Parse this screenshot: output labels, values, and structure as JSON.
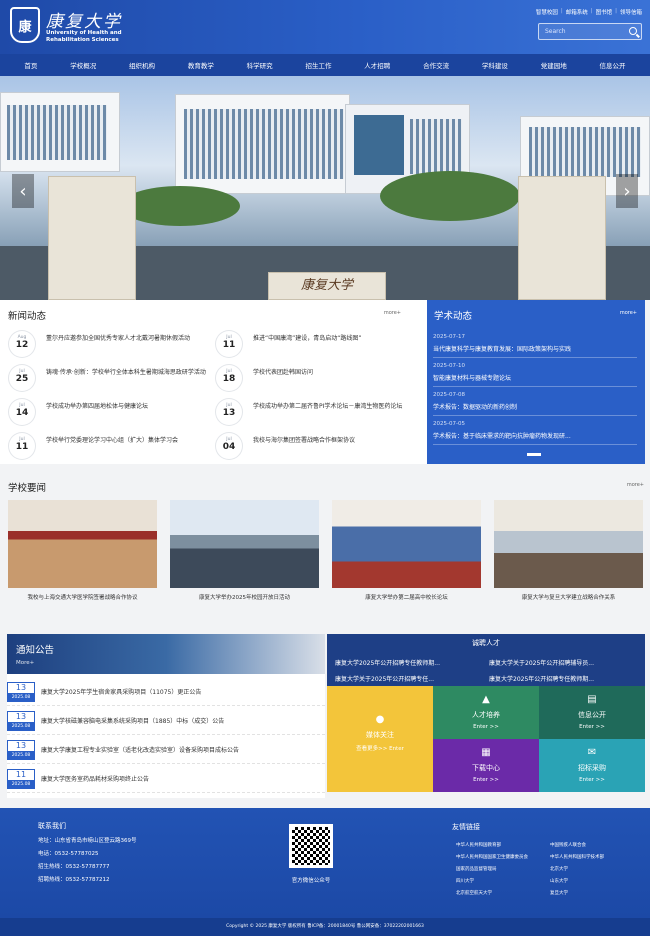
{
  "header": {
    "logo_text": "康",
    "name_cn": "康复大学",
    "name_en_1": "University of Health and",
    "name_en_2": "Rehabilitation Sciences",
    "links": [
      "智慧校园",
      "邮箱系统",
      "图书馆",
      "领导信箱"
    ],
    "search_placeholder": "Search"
  },
  "nav": [
    "首页",
    "学校概况",
    "组织机构",
    "教育教学",
    "科学研究",
    "招生工作",
    "人才招聘",
    "合作交流",
    "学科建设",
    "党建园地",
    "信息公开"
  ],
  "hero": {
    "sign": "康复大学"
  },
  "news": {
    "title": "新闻动态",
    "more": "more+",
    "items": [
      {
        "m": "Aug",
        "d": "12",
        "t": "董尔丹应邀参加全国优秀专家人才北戴河暑期休假活动"
      },
      {
        "m": "Jul",
        "d": "11",
        "t": "推进“中国康湾”建设，青岛启动“路线图”"
      },
      {
        "m": "Jul",
        "d": "25",
        "t": "铸魂·传承·创新：学校举行全体本科生暑期城海思政研学活动"
      },
      {
        "m": "Jul",
        "d": "18",
        "t": "学校代表团赴韩国访问"
      },
      {
        "m": "Jul",
        "d": "14",
        "t": "学校成功举办第四届地松体与健康论坛"
      },
      {
        "m": "Jul",
        "d": "13",
        "t": "学校成功举办第二届齐鲁PI学术论坛－康湾生物医药论坛"
      },
      {
        "m": "Jul",
        "d": "11",
        "t": "学校举行党委理论学习中心组（扩大）集体学习会"
      },
      {
        "m": "Jul",
        "d": "04",
        "t": "我校与海尔集团签署战略合作框架协议"
      }
    ]
  },
  "academic": {
    "title": "学术动态",
    "more": "more+",
    "items": [
      {
        "d": "2025-07-17",
        "t": "当代康复科学与康复教育发展：国际政策架构与实践"
      },
      {
        "d": "2025-07-10",
        "t": "智能康复材料与器械专题论坛"
      },
      {
        "d": "2025-07-08",
        "t": "学术报告：数据驱动的新药创制"
      },
      {
        "d": "2025-07-05",
        "t": "学术报告：基于临床需求的靶向抗肿瘤药物发现研..."
      }
    ]
  },
  "key_news": {
    "title": "学校要闻",
    "more": "more+",
    "items": [
      "我校与上海交通大学医学院签署战略合作协议",
      "康复大学举办2025年校园开放日活动",
      "康复大学举办第二届高中校长论坛",
      "康复大学与复旦大学建立战略合作关系"
    ]
  },
  "notice": {
    "title": "通知公告",
    "more": "More+",
    "items": [
      {
        "d": "13",
        "m": "2025.08",
        "t": "康复大学2025年学生宿舍家具采购项目（11075）更正公告"
      },
      {
        "d": "13",
        "m": "2025.08",
        "t": "康复大学核磁兼容脑电采集系统采购项目（1885）中标（成交）公告"
      },
      {
        "d": "13",
        "m": "2025.08",
        "t": "康复大学康复工程专业实验室（适老化改造实验室）设备采购项目成标公告"
      },
      {
        "d": "11",
        "m": "2025.08",
        "t": "康复大学医务室药品耗材采购项终止公告"
      }
    ]
  },
  "recruit": {
    "title": "诚聘人才",
    "items": [
      "康复大学2025年公开招聘专任教师期...",
      "康复大学关于2025年公开招聘辅导员...",
      "康复大学关于2025年公开招聘专任...",
      "康复大学2025年公开招聘专任教师期..."
    ]
  },
  "tiles": [
    {
      "t": "媒体关注",
      "en": "查看更多>> Enter",
      "color": "#f3c53a"
    },
    {
      "t": "人才培养",
      "en": "Enter >>",
      "color": "#2e8a62"
    },
    {
      "t": "信息公开",
      "en": "Enter >>",
      "color": "#1f6a5a"
    },
    {
      "t": "下载中心",
      "en": "Enter >>",
      "color": "#6b2aa8"
    },
    {
      "t": "招标采购",
      "en": "Enter >>",
      "color": "#2aa3b5"
    }
  ],
  "footer": {
    "contact_title": "联系我们",
    "address": "地址：山东省青岛市崂山区登云路369号",
    "phone": "电话：0532-57787025",
    "admission": "招生热线：0532-57787777",
    "hr": "招聘热线：0532-57787212",
    "qr_label": "官方微信公众号",
    "links_title": "友情链接",
    "links": [
      "中华人民共和国教育部",
      "中国残疾人联合会",
      "中华人民共和国国家卫生健康委员会",
      "中华人民共和国科学技术部",
      "国家药品监督管理局",
      "北京大学",
      "四川大学",
      "山东大学",
      "北京航空航天大学",
      "复旦大学"
    ],
    "copyright": "Copyright © 2025 康复大学  版权所有  鲁ICP备：20001840号  鲁公网安备：37022202001663"
  }
}
